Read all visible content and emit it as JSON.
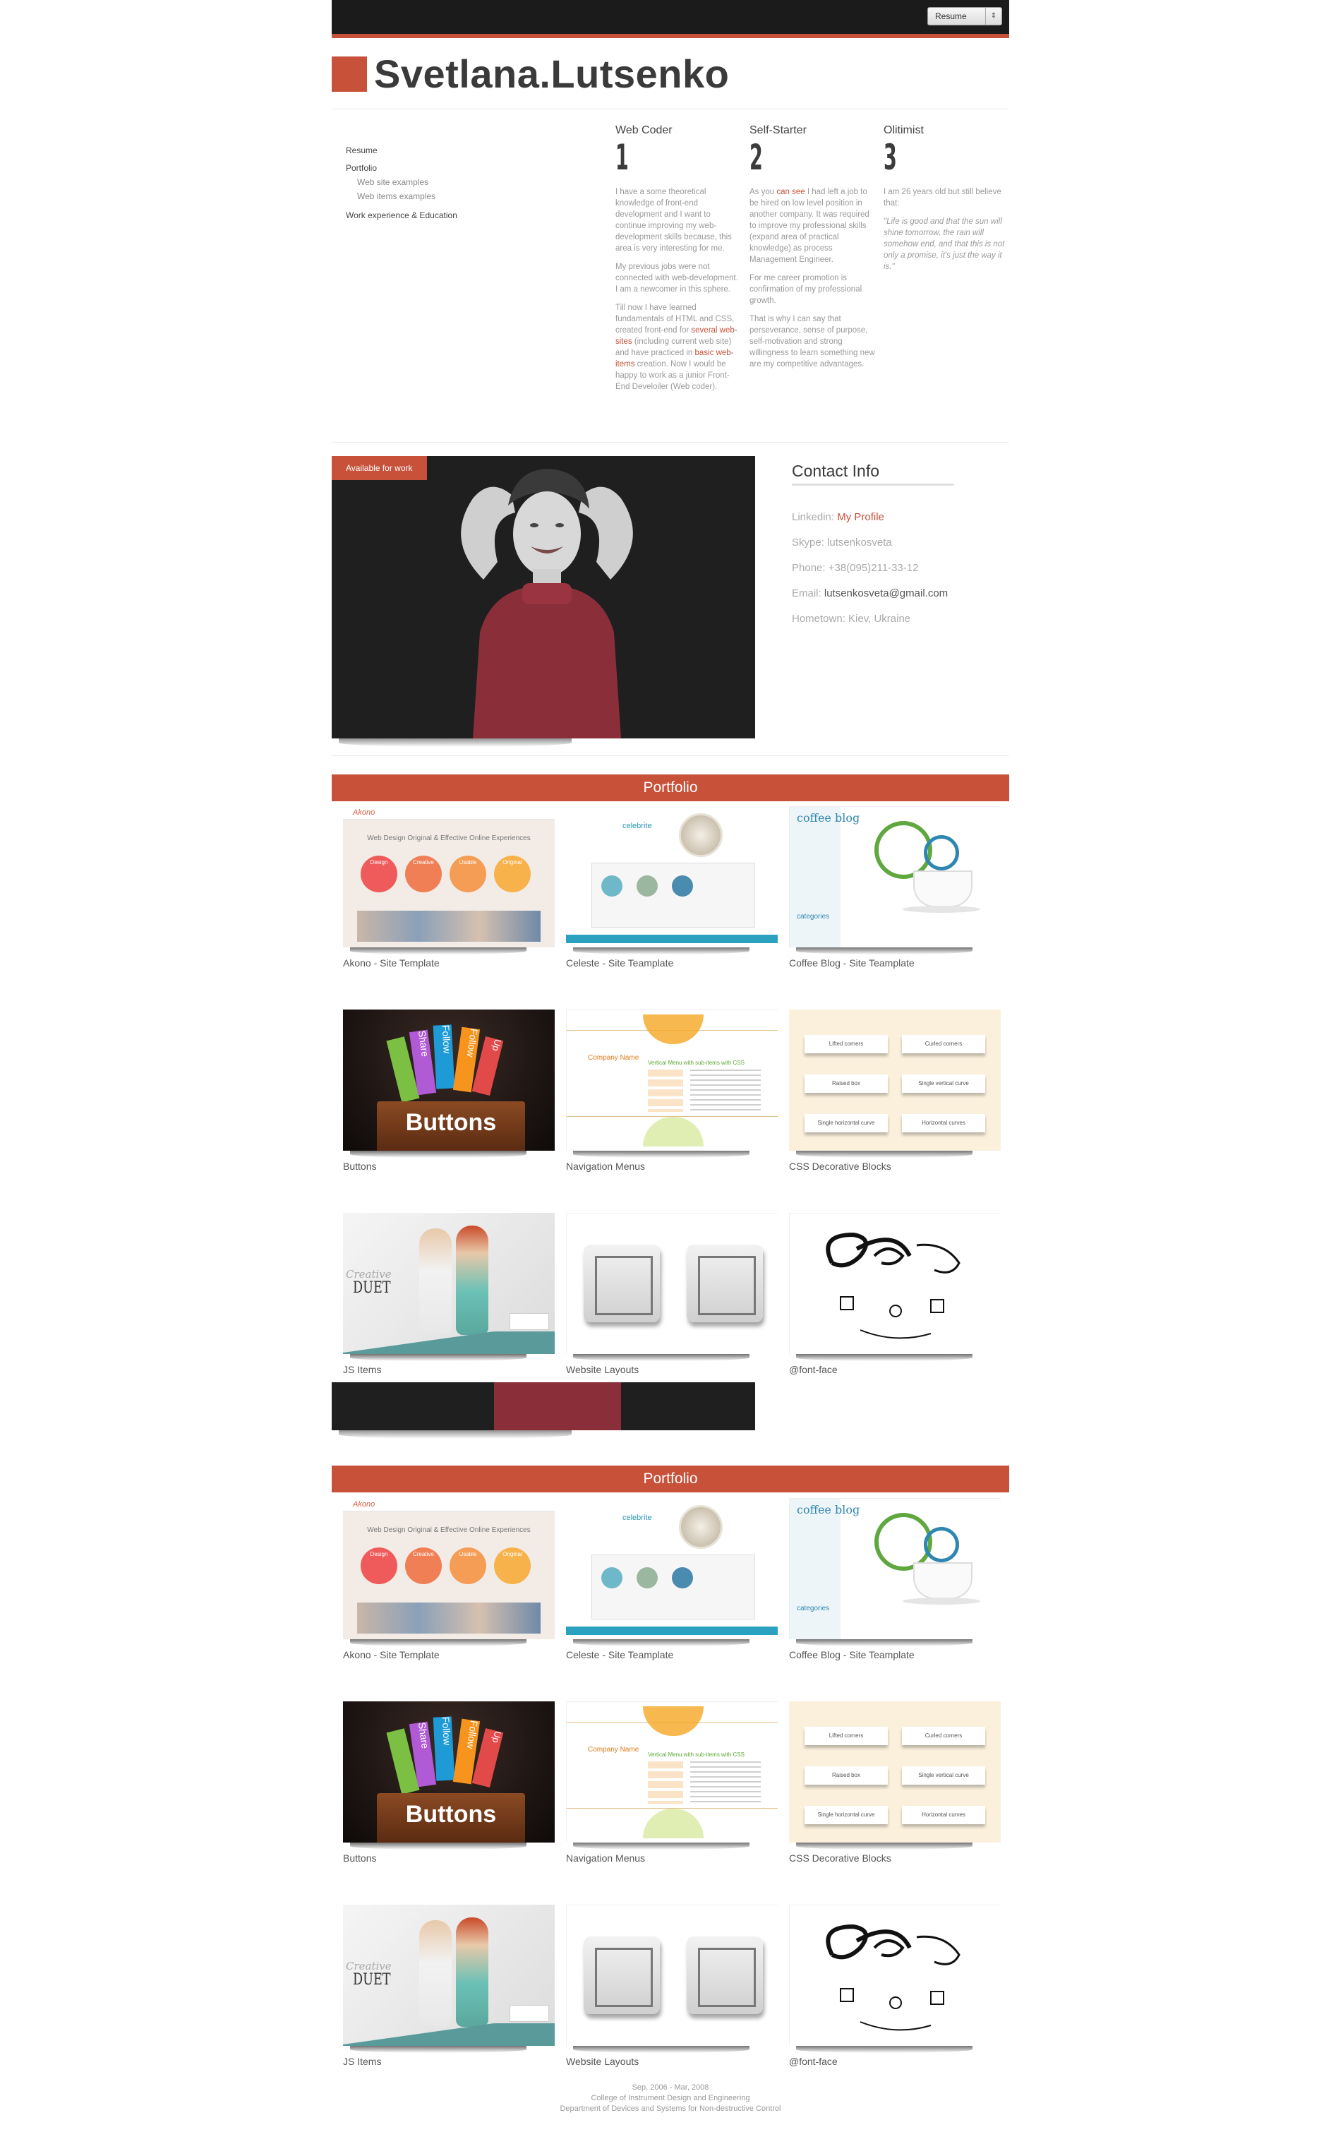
{
  "topbar": {
    "select_value": "Resume"
  },
  "header": {
    "title": "Svetlana.Lutsenko"
  },
  "nav": {
    "items": [
      {
        "label": "Resume"
      },
      {
        "label": "Portfolio"
      },
      {
        "label": "Web site examples"
      },
      {
        "label": "Web items examples"
      },
      {
        "label": "Work experience & Education"
      }
    ]
  },
  "features": [
    {
      "title": "Web Coder",
      "number": "1",
      "p1": "I have a some theoretical knowledge of front-end development and I want to continue improving my web-development skills because, this area is very interesting for me.",
      "p2": "My previous jobs were not connected with web-development. I am a newcomer in this sphere.",
      "p3a": "Till now I have learned fundamentals of HTML and CSS, created front-end for ",
      "link1": "several web-sites",
      "p3b": " (including current web site) and have practiced in ",
      "link2": "basic web-items",
      "p3c": " creation. Now I would be happy to work as a junior Front-End Develoiler (Web coder)."
    },
    {
      "title": "Self-Starter",
      "number": "2",
      "p1a": "As you ",
      "link1": "can see",
      "p1b": " I had left a job to be hired on low level position in another company. It was required to improve my professional skills (expand area of practical knowledge) as process Management Engineer.",
      "p2": "For me career promotion is confirmation of my professional growth.",
      "p3": "That is why I can say that perseverance, sense of purpose, self-motivation and strong willingness to learn something new are my competitive advantages."
    },
    {
      "title": "Olitimist",
      "number": "3",
      "p1": "I am 26 years old but still believe that:",
      "quote": "\"Life is good and that the sun will shine tomorrow, the rain will somehow end, and that this is not only a promise, it's just the way it is.\""
    }
  ],
  "photo": {
    "badge": "Available for work"
  },
  "contact": {
    "title": "Contact Info",
    "linkedin_label": "Linkedin:",
    "linkedin_value": "My Profile",
    "skype_label": "Skype:",
    "skype_value": "lutsenkosveta",
    "phone_label": "Phone:",
    "phone_value": "+38(095)211-33-12",
    "email_label": "Email:",
    "email_value": "lutsenkosveta@gmail.com",
    "hometown_label": "Hometown:",
    "hometown_value": "Kiev, Ukraine"
  },
  "portfolio": {
    "title": "Portfolio",
    "items": [
      {
        "caption": "Akono - Site Template"
      },
      {
        "caption": "Celeste - Site Teamplate"
      },
      {
        "caption": "Coffee Blog - Site Teamplate"
      },
      {
        "caption": "Buttons"
      },
      {
        "caption": "Navigation Menus"
      },
      {
        "caption": "CSS Decorative Blocks"
      },
      {
        "caption": "JS Items"
      },
      {
        "caption": "Website Layouts"
      },
      {
        "caption": "@font-face"
      }
    ],
    "thumb_text": {
      "akono_logo": "Akono",
      "akono_headline": "Web Design Original & Effective Online Experiences",
      "akono_circles": [
        "Design",
        "Creative",
        "Usable",
        "Original"
      ],
      "celeste_logo": "celebrite",
      "coffee_logo": "coffee blog",
      "coffee_categories": "categories",
      "buttons_label": "Buttons",
      "buttons_tags": [
        "Share",
        "Follow",
        "Follow",
        "Up"
      ],
      "nav_company": "Company Name",
      "nav_menu": "Vertical Menu with sub-items with CSS",
      "css_blocks": [
        "Lifted corners",
        "Curled corners",
        "Raised box",
        "Single vertical curve",
        "Single horizontal curve",
        "Horizontal curves"
      ],
      "js_creative": "Creative",
      "js_duet": "DUET"
    }
  },
  "footer": {
    "dates": "Sep, 2006 - Mar, 2008",
    "college": "College of Instrument Design and Engineering",
    "department": "Department of Devices and Systems for Non-destructive Control"
  }
}
